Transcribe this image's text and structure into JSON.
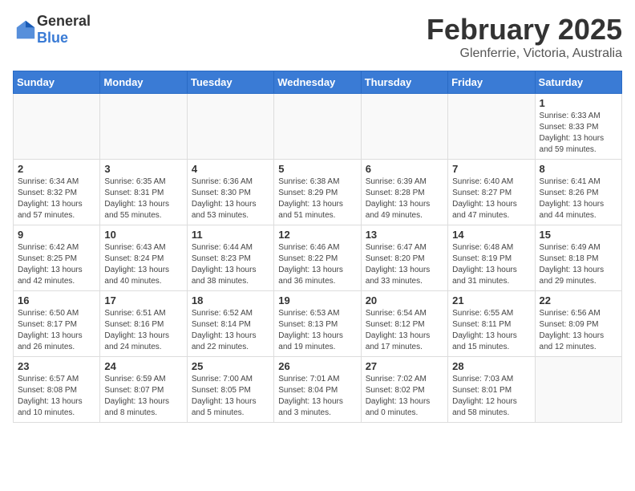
{
  "header": {
    "logo_general": "General",
    "logo_blue": "Blue",
    "month": "February 2025",
    "location": "Glenferrie, Victoria, Australia"
  },
  "weekdays": [
    "Sunday",
    "Monday",
    "Tuesday",
    "Wednesday",
    "Thursday",
    "Friday",
    "Saturday"
  ],
  "weeks": [
    [
      {
        "day": "",
        "info": ""
      },
      {
        "day": "",
        "info": ""
      },
      {
        "day": "",
        "info": ""
      },
      {
        "day": "",
        "info": ""
      },
      {
        "day": "",
        "info": ""
      },
      {
        "day": "",
        "info": ""
      },
      {
        "day": "1",
        "info": "Sunrise: 6:33 AM\nSunset: 8:33 PM\nDaylight: 13 hours\nand 59 minutes."
      }
    ],
    [
      {
        "day": "2",
        "info": "Sunrise: 6:34 AM\nSunset: 8:32 PM\nDaylight: 13 hours\nand 57 minutes."
      },
      {
        "day": "3",
        "info": "Sunrise: 6:35 AM\nSunset: 8:31 PM\nDaylight: 13 hours\nand 55 minutes."
      },
      {
        "day": "4",
        "info": "Sunrise: 6:36 AM\nSunset: 8:30 PM\nDaylight: 13 hours\nand 53 minutes."
      },
      {
        "day": "5",
        "info": "Sunrise: 6:38 AM\nSunset: 8:29 PM\nDaylight: 13 hours\nand 51 minutes."
      },
      {
        "day": "6",
        "info": "Sunrise: 6:39 AM\nSunset: 8:28 PM\nDaylight: 13 hours\nand 49 minutes."
      },
      {
        "day": "7",
        "info": "Sunrise: 6:40 AM\nSunset: 8:27 PM\nDaylight: 13 hours\nand 47 minutes."
      },
      {
        "day": "8",
        "info": "Sunrise: 6:41 AM\nSunset: 8:26 PM\nDaylight: 13 hours\nand 44 minutes."
      }
    ],
    [
      {
        "day": "9",
        "info": "Sunrise: 6:42 AM\nSunset: 8:25 PM\nDaylight: 13 hours\nand 42 minutes."
      },
      {
        "day": "10",
        "info": "Sunrise: 6:43 AM\nSunset: 8:24 PM\nDaylight: 13 hours\nand 40 minutes."
      },
      {
        "day": "11",
        "info": "Sunrise: 6:44 AM\nSunset: 8:23 PM\nDaylight: 13 hours\nand 38 minutes."
      },
      {
        "day": "12",
        "info": "Sunrise: 6:46 AM\nSunset: 8:22 PM\nDaylight: 13 hours\nand 36 minutes."
      },
      {
        "day": "13",
        "info": "Sunrise: 6:47 AM\nSunset: 8:20 PM\nDaylight: 13 hours\nand 33 minutes."
      },
      {
        "day": "14",
        "info": "Sunrise: 6:48 AM\nSunset: 8:19 PM\nDaylight: 13 hours\nand 31 minutes."
      },
      {
        "day": "15",
        "info": "Sunrise: 6:49 AM\nSunset: 8:18 PM\nDaylight: 13 hours\nand 29 minutes."
      }
    ],
    [
      {
        "day": "16",
        "info": "Sunrise: 6:50 AM\nSunset: 8:17 PM\nDaylight: 13 hours\nand 26 minutes."
      },
      {
        "day": "17",
        "info": "Sunrise: 6:51 AM\nSunset: 8:16 PM\nDaylight: 13 hours\nand 24 minutes."
      },
      {
        "day": "18",
        "info": "Sunrise: 6:52 AM\nSunset: 8:14 PM\nDaylight: 13 hours\nand 22 minutes."
      },
      {
        "day": "19",
        "info": "Sunrise: 6:53 AM\nSunset: 8:13 PM\nDaylight: 13 hours\nand 19 minutes."
      },
      {
        "day": "20",
        "info": "Sunrise: 6:54 AM\nSunset: 8:12 PM\nDaylight: 13 hours\nand 17 minutes."
      },
      {
        "day": "21",
        "info": "Sunrise: 6:55 AM\nSunset: 8:11 PM\nDaylight: 13 hours\nand 15 minutes."
      },
      {
        "day": "22",
        "info": "Sunrise: 6:56 AM\nSunset: 8:09 PM\nDaylight: 13 hours\nand 12 minutes."
      }
    ],
    [
      {
        "day": "23",
        "info": "Sunrise: 6:57 AM\nSunset: 8:08 PM\nDaylight: 13 hours\nand 10 minutes."
      },
      {
        "day": "24",
        "info": "Sunrise: 6:59 AM\nSunset: 8:07 PM\nDaylight: 13 hours\nand 8 minutes."
      },
      {
        "day": "25",
        "info": "Sunrise: 7:00 AM\nSunset: 8:05 PM\nDaylight: 13 hours\nand 5 minutes."
      },
      {
        "day": "26",
        "info": "Sunrise: 7:01 AM\nSunset: 8:04 PM\nDaylight: 13 hours\nand 3 minutes."
      },
      {
        "day": "27",
        "info": "Sunrise: 7:02 AM\nSunset: 8:02 PM\nDaylight: 13 hours\nand 0 minutes."
      },
      {
        "day": "28",
        "info": "Sunrise: 7:03 AM\nSunset: 8:01 PM\nDaylight: 12 hours\nand 58 minutes."
      },
      {
        "day": "",
        "info": ""
      }
    ]
  ]
}
